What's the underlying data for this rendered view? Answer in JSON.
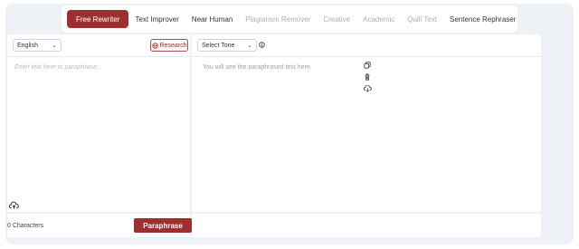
{
  "tabs": [
    {
      "label": "Free Rewriter",
      "state": "active"
    },
    {
      "label": "Text Improver",
      "state": "normal"
    },
    {
      "label": "Near Human",
      "state": "normal"
    },
    {
      "label": "Plagiarism Remover",
      "state": "disabled"
    },
    {
      "label": "Creative",
      "state": "disabled"
    },
    {
      "label": "Academic",
      "state": "disabled"
    },
    {
      "label": "Quill Text",
      "state": "disabled"
    },
    {
      "label": "Sentence Rephraser",
      "state": "normal"
    }
  ],
  "input_panel": {
    "language": "English",
    "research_label": "Research",
    "placeholder": "Enter text here to paraphrase..."
  },
  "output_panel": {
    "tone_label": "Select Tone",
    "output_text": "You will see the paraphrased text here."
  },
  "footer": {
    "character_count": "0 Characters",
    "paraphrase_label": "Paraphrase"
  },
  "colors": {
    "accent": "#9e2f2f",
    "background": "#eef1f6"
  }
}
